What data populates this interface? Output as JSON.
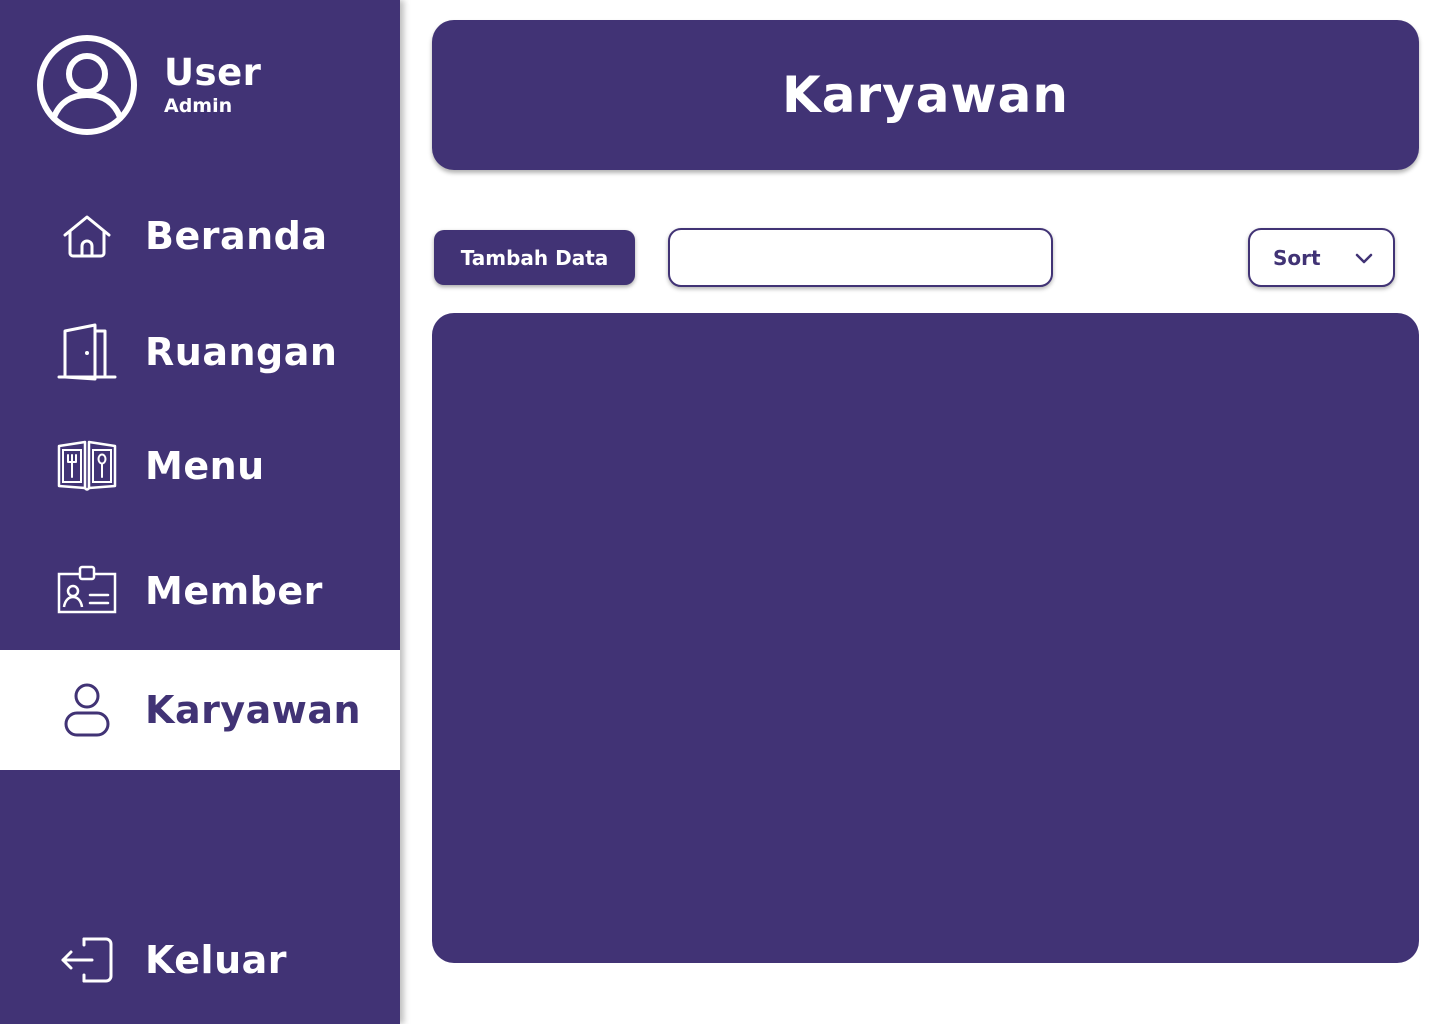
{
  "colors": {
    "primary": "#413375",
    "background": "#ffffff",
    "text_on_primary": "#ffffff"
  },
  "profile": {
    "icon": "user-circle-icon",
    "name": "User",
    "role": "Admin"
  },
  "sidebar": {
    "items": [
      {
        "label": "Beranda",
        "icon": "home-icon",
        "active": false
      },
      {
        "label": "Ruangan",
        "icon": "door-icon",
        "active": false
      },
      {
        "label": "Menu",
        "icon": "menu-book-icon",
        "active": false
      },
      {
        "label": "Member",
        "icon": "id-card-icon",
        "active": false
      },
      {
        "label": "Karyawan",
        "icon": "person-icon",
        "active": true
      }
    ],
    "logout": {
      "label": "Keluar",
      "icon": "logout-icon"
    }
  },
  "header": {
    "title": "Karyawan"
  },
  "toolbar": {
    "add_label": "Tambah Data",
    "search_value": "",
    "sort_label": "Sort",
    "sort_icon": "chevron-down-icon"
  }
}
